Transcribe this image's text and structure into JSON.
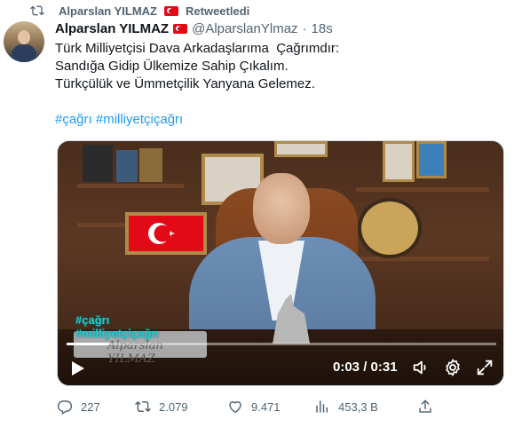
{
  "retweet": {
    "name": "Alparslan YILMAZ",
    "label": "Retweetledi"
  },
  "tweet": {
    "author_name": "Alparslan YILMAZ",
    "handle": "@AlparslanYlmaz",
    "separator": "·",
    "time": "18s",
    "text": "Türk Milliyetçisi Dava Arkadaşlarıma  Çağrımdır:\nSandığa Gidip Ülkemize Sahip Çıkalım.\nTürkçülük ve Ümmetçilik Yanyana Gelemez.",
    "hashtags": "#çağrı #milliyetçiçağrı"
  },
  "video": {
    "nameplate": "Alparslan YILMAZ",
    "overlay_tags": [
      "#çağrı",
      "#milliyetçiçağrı"
    ],
    "time_readout": "0:03 / 0:31",
    "progress_fraction": 0.1
  },
  "actions": {
    "reply_count": "227",
    "retweet_count": "2.079",
    "like_count": "9.471",
    "views_count": "453,3 B"
  },
  "icons": {
    "retweet": "retweet-icon",
    "reply": "reply-icon",
    "like": "heart-icon",
    "views": "views-icon",
    "share": "share-icon",
    "play": "play-icon",
    "volume": "volume-icon",
    "settings": "gear-icon",
    "fullscreen": "fullscreen-icon",
    "flag": "turkey-flag-icon"
  },
  "colors": {
    "accent": "#1d9bf0",
    "muted": "#536471",
    "flag": "#e30a17"
  }
}
